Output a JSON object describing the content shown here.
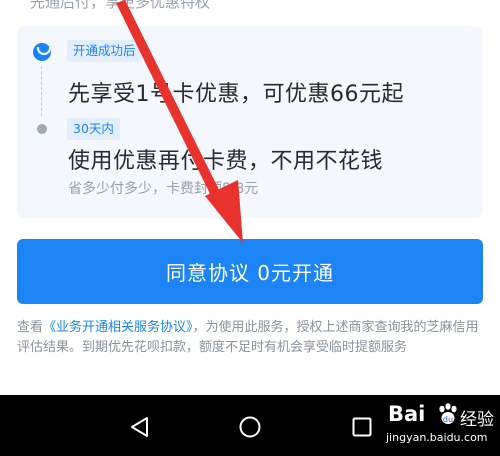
{
  "partial_top_text": "先通后付，享更多优惠特权",
  "steps": [
    {
      "tag": "开通成功后",
      "title": "先享受1号卡优惠，可优惠66元起"
    },
    {
      "tag": "30天内",
      "title": "使用优惠再付卡费，不用不花钱",
      "subtitle": "省多少付多少，卡费封顶8.8元"
    }
  ],
  "cta": {
    "label": "同意协议 0元开通"
  },
  "agreement": {
    "prefix": "查看",
    "link": "《业务开通相关服务协议》",
    "suffix": "，为使用此服务，授权上述商家查询我的芝麻信用评估结果。到期优先花呗扣款，额度不足时有机会享受临时提额服务"
  },
  "navbar": {
    "icons": [
      "back-icon",
      "home-icon",
      "recent-apps-icon"
    ]
  },
  "watermark": {
    "brand": "Bai",
    "suffix": "经验",
    "url": "jingyan.baidu.com"
  },
  "colors": {
    "accent": "#1d84f5",
    "annotation_arrow": "#e8322e",
    "card_bg": "#f4f7fc",
    "muted_text": "#9aa1aa"
  }
}
